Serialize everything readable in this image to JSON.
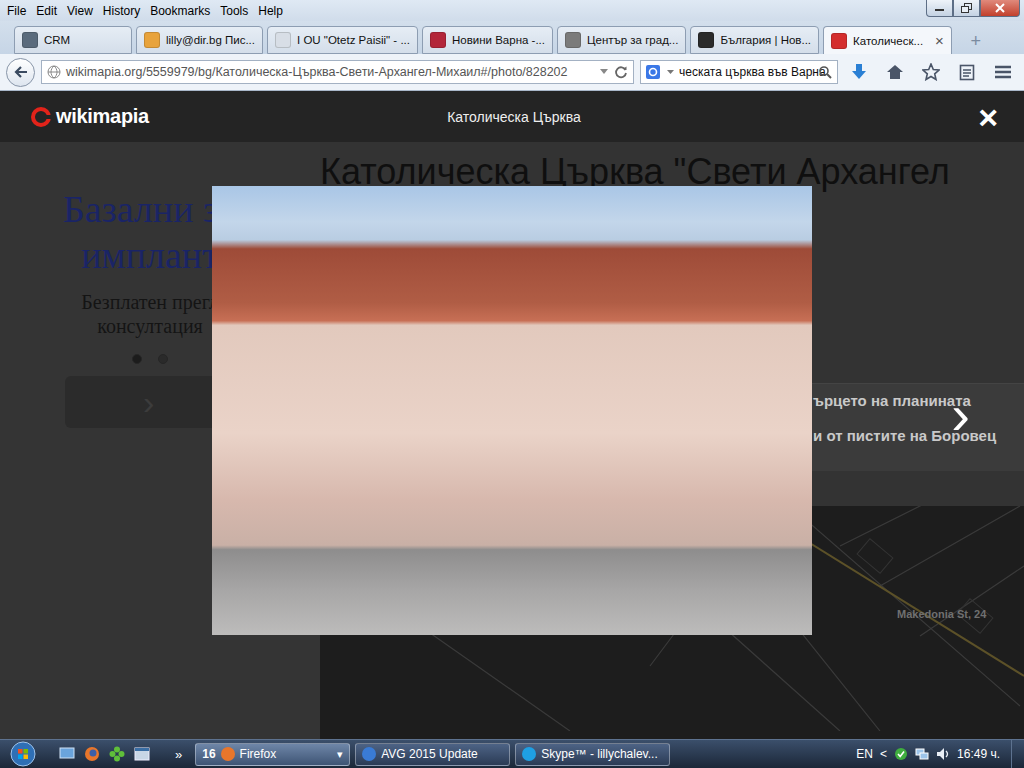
{
  "menu": [
    "File",
    "Edit",
    "View",
    "History",
    "Bookmarks",
    "Tools",
    "Help"
  ],
  "tabs": [
    {
      "label": "CRM",
      "selected": false,
      "color": "#5a6b7d"
    },
    {
      "label": "lilly@dir.bg Пис...",
      "selected": false,
      "color": "#e8a33c"
    },
    {
      "label": "I OU \"Otetz Paisii\" - ...",
      "selected": false,
      "color": "#d8dee6"
    },
    {
      "label": "Новини Варна -...",
      "selected": false,
      "color": "#b3263a"
    },
    {
      "label": "Център за град...",
      "selected": false,
      "color": "#7b7b7b"
    },
    {
      "label": "България | Нов...",
      "selected": false,
      "color": "#2b2b2b"
    },
    {
      "label": "Католическ...",
      "selected": true,
      "color": "#d42e2e"
    }
  ],
  "tab_close": "×",
  "new_tab": "+",
  "address": {
    "url": "wikimapia.org/5559979/bg/Католическа-Църква-Свети-Архангел-Михаил#/photo/828202"
  },
  "search": {
    "value": "ческата църква във Варна"
  },
  "lightbox": {
    "logo": "wikimapia",
    "title": "Католическа Църква",
    "close": "×",
    "next": "›"
  },
  "page": {
    "ad": {
      "title_lines": [
        "Базални зъ",
        "имплант"
      ],
      "subtitle_lines": [
        "Безплатен прегл",
        "консултация"
      ],
      "dots": [
        {
          "selected": true
        },
        {
          "selected": false
        }
      ],
      "button": "›"
    },
    "title": "Католическа Църква \"Свети Архангел",
    "panel_lines": [
      "ърцето на планината",
      "и от пистите на Боровец"
    ],
    "map_label": "Makedonia St, 24"
  },
  "taskbar": {
    "more": "»",
    "tasks": [
      {
        "label": "Firefox",
        "count": "16",
        "arrow": "▾",
        "selected": true,
        "color": "#e8762b"
      },
      {
        "label": "AVG 2015 Update",
        "selected": false,
        "color": "#3a7bd5"
      },
      {
        "label": "Skype™ - lillychalev...",
        "selected": false,
        "color": "#1fa0e3"
      }
    ],
    "language": "EN",
    "tray_arrow": "<",
    "clock": "16:49 ч."
  }
}
